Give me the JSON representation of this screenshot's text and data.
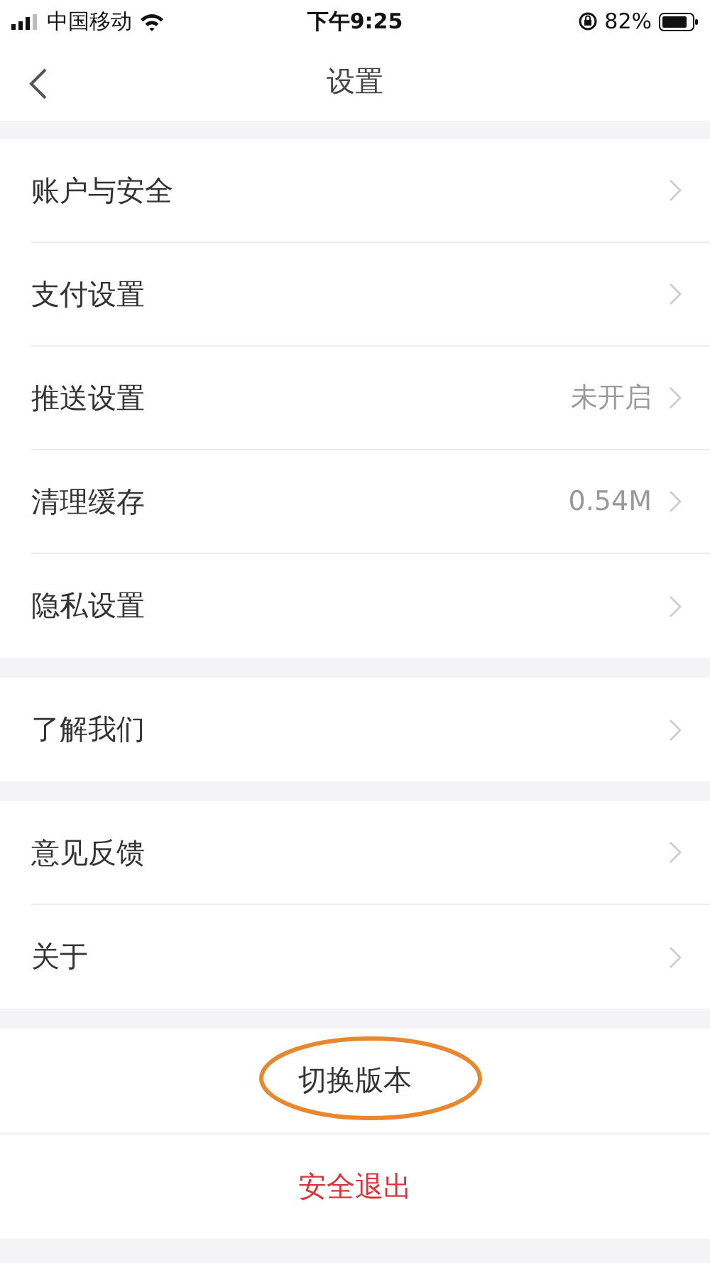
{
  "status_bar": {
    "carrier": "中国移动",
    "time": "下午9:25",
    "battery": "82%"
  },
  "nav": {
    "title": "设置"
  },
  "groups": [
    {
      "items": [
        {
          "label": "账户与安全"
        },
        {
          "label": "支付设置"
        },
        {
          "label": "推送设置",
          "value": "未开启"
        },
        {
          "label": "清理缓存",
          "value": "0.54M"
        },
        {
          "label": "隐私设置"
        }
      ]
    },
    {
      "items": [
        {
          "label": "了解我们"
        }
      ]
    },
    {
      "items": [
        {
          "label": "意见反馈"
        },
        {
          "label": "关于"
        }
      ]
    }
  ],
  "actions": [
    {
      "label": "切换版本",
      "kind": "normal",
      "highlighted": true
    },
    {
      "label": "安全退出",
      "kind": "danger",
      "highlighted": false
    }
  ]
}
